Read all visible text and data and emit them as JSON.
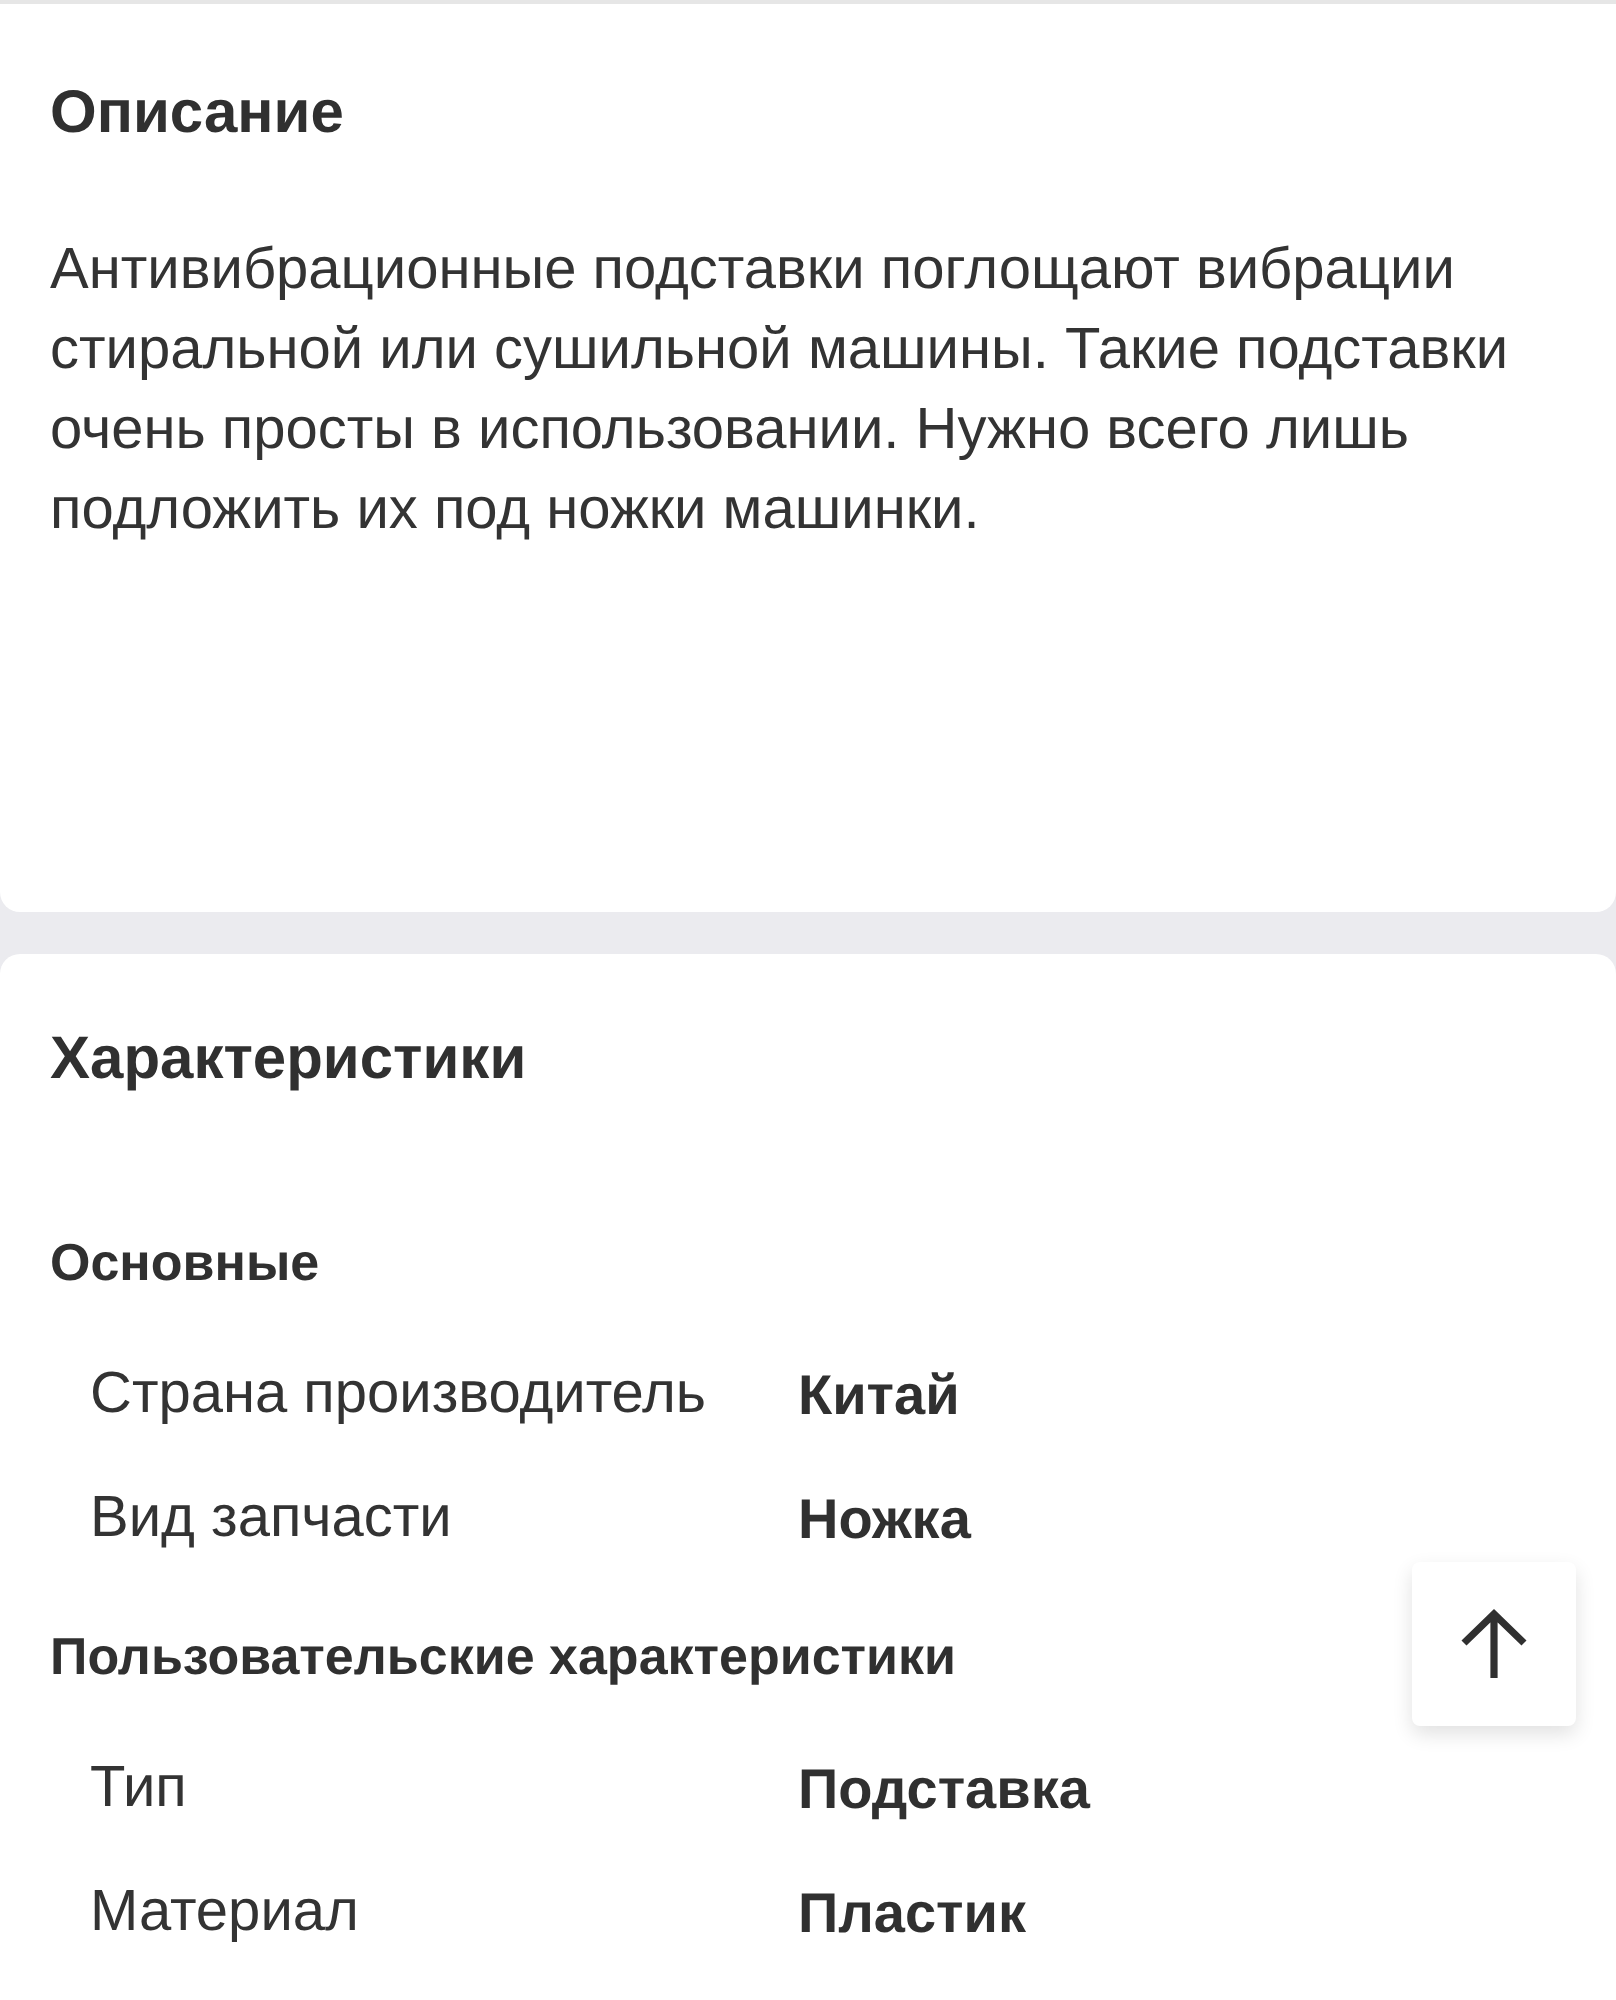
{
  "description": {
    "title": "Описание",
    "text": "Антивибрационные подставки поглощают вибрации стиральной или сушильной машины. Такие подставки очень просты в использовании. Нужно всего лишь подложить их под ножки машинки."
  },
  "specs": {
    "title": "Характеристики",
    "groups": [
      {
        "title": "Основные",
        "rows": [
          {
            "name": "Страна производитель",
            "value": "Китай"
          },
          {
            "name": "Вид запчасти",
            "value": "Ножка"
          }
        ]
      },
      {
        "title": "Пользовательские характеристики",
        "rows": [
          {
            "name": "Тип",
            "value": "Подставка"
          },
          {
            "name": "Материал",
            "value": "Пластик"
          }
        ]
      }
    ]
  }
}
